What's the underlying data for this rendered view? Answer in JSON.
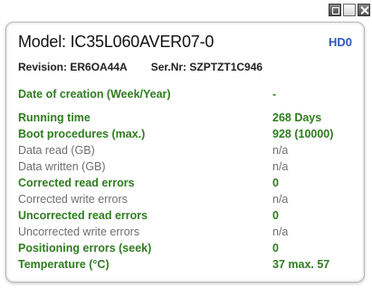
{
  "window": {
    "controls": [
      "restore-icon",
      "maximize-icon",
      "close-icon"
    ]
  },
  "header": {
    "model_label": "Model: IC35L060AVER07-0",
    "drive_badge": "HD0",
    "revision_label": "Revision: ER6OA44A",
    "serial_label": "Ser.Nr: SZPTZT1C946"
  },
  "rows": [
    {
      "label": "Date of creation (Week/Year)",
      "value": "-",
      "style": "hl"
    },
    {
      "label": "Running time",
      "value": "268 Days",
      "style": "hl"
    },
    {
      "label": "Boot procedures (max.)",
      "value": "928 (10000)",
      "style": "hl"
    },
    {
      "label": "Data read (GB)",
      "value": "n/a",
      "style": "dim"
    },
    {
      "label": "Data written (GB)",
      "value": "n/a",
      "style": "dim"
    },
    {
      "label": "Corrected read errors",
      "value": "0",
      "style": "hl"
    },
    {
      "label": "Corrected write errors",
      "value": "n/a",
      "style": "dim"
    },
    {
      "label": "Uncorrected read errors",
      "value": "0",
      "style": "hl"
    },
    {
      "label": "Uncorrected write errors",
      "value": "n/a",
      "style": "dim"
    },
    {
      "label": "Positioning errors (seek)",
      "value": "0",
      "style": "hl"
    },
    {
      "label": "Temperature (°C)",
      "value": "37 max. 57",
      "style": "hl"
    }
  ],
  "colors": {
    "highlight": "#2e7d1e",
    "dim": "#6f6f6f",
    "badge": "#2a56c6"
  }
}
